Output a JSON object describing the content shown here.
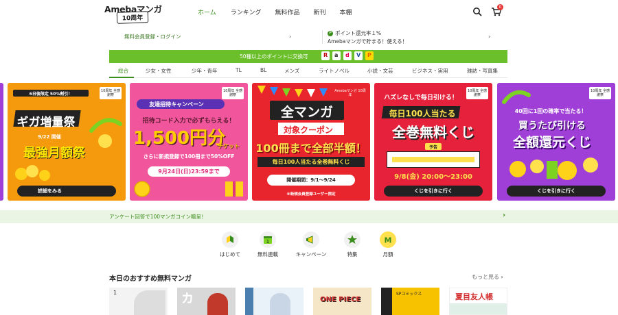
{
  "header": {
    "logo_text": "Amebaマンガ",
    "logo_badge": "10周年",
    "nav": [
      {
        "label": "ホーム",
        "active": true
      },
      {
        "label": "ランキング",
        "active": false
      },
      {
        "label": "無料作品",
        "active": false
      },
      {
        "label": "新刊",
        "active": false
      },
      {
        "label": "本棚",
        "active": false
      }
    ],
    "cart_count": "0",
    "accent_color": "#3a8c1c"
  },
  "subrow": {
    "login_link": "無料会員登録・ログイン",
    "point_badge": "P",
    "point_line1": "ポイント還元率１%",
    "point_line2": "Amebaマンガで貯まる！使える！"
  },
  "greenbar": {
    "text": "50種以上のポイントに交換可",
    "partner_logos": [
      "R",
      "a",
      "d",
      "V",
      "P"
    ]
  },
  "categories": [
    "総合",
    "少女・女性",
    "少年・青年",
    "TL",
    "BL",
    "メンズ",
    "ライトノベル",
    "小説・文芸",
    "ビジネス・実用",
    "雑誌・写真集"
  ],
  "banners": [
    {
      "corner": "10周年 全感謝祭",
      "top": "6日後限定 50%割引！",
      "main": "ギガ増量祭",
      "sub": "最強月額祭",
      "note": "9/22 開催",
      "button": "詳細をみる"
    },
    {
      "corner": "10周年 全感謝祭",
      "tag": "友達招待キャンペーン",
      "line1": "招待コード入力で必ずもらえる！",
      "amount": "1,500円分",
      "unit": "チケット",
      "line2": "さらに新規登録で100冊まで50%OFF",
      "deadline": "9月24日(日)23:59まで"
    },
    {
      "corner": "Amebaマンガ 10周年",
      "title": "全マンガ",
      "subtitle": "対象クーポン",
      "main": "100冊まで全部半額！",
      "strip": "毎日100人当たる全巻無料くじ",
      "period": "開催期間：9/1〜9/24",
      "note": "※新規会員登録ユーザー限定"
    },
    {
      "corner": "10周年 全感謝祭",
      "top": "ハズレなしで毎日引ける！",
      "main1": "毎日100人当たる",
      "main2": "全巻無料くじ",
      "tag": "予告",
      "date": "9/8(金) 20:00〜23:00",
      "button": "くじを引きに行く"
    },
    {
      "corner": "10周年 全感謝祭",
      "top": "40回に1回の確率で当たる！",
      "main1": "買うたび引ける",
      "main2": "全額還元くじ",
      "button": "くじを引きに行く"
    }
  ],
  "survey": {
    "text": "アンケート回答で100マンガコイン贈呈！"
  },
  "quick_links": [
    {
      "label": "はじめて",
      "icon": "beginner-leaf-icon"
    },
    {
      "label": "無料連載",
      "icon": "calendar-one-icon"
    },
    {
      "label": "キャンペーン",
      "icon": "megaphone-icon"
    },
    {
      "label": "特集",
      "icon": "star-icon"
    },
    {
      "label": "月額",
      "icon": "m-icon"
    }
  ],
  "recommend": {
    "title": "本日のおすすめ無料マンガ",
    "more": "もっと見る",
    "covers": [
      {
        "label": "1"
      },
      {
        "label": "カ"
      },
      {
        "label": ""
      },
      {
        "label": "ONE PIECE"
      },
      {
        "label": "SPコミックス"
      },
      {
        "label": "夏目友人帳"
      }
    ]
  }
}
